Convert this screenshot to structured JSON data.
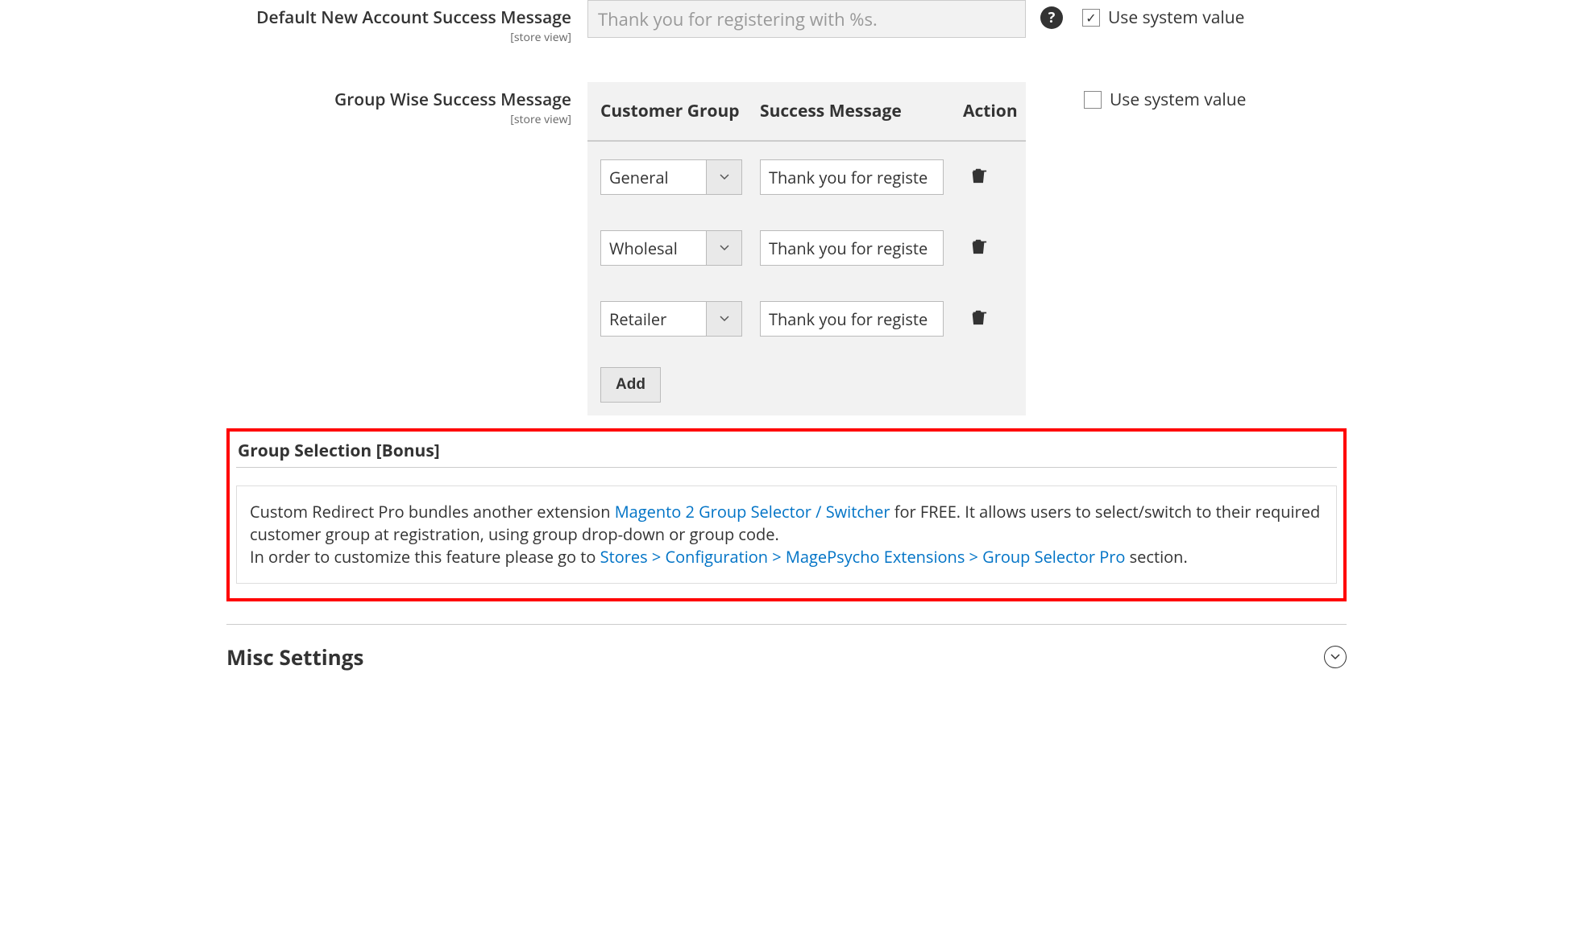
{
  "fields": {
    "default_success": {
      "label": "Default New Account Success Message",
      "scope": "[store view]",
      "value": "Thank you for registering with %s.",
      "use_system_label": "Use system value",
      "use_system_checked": true
    },
    "group_wise": {
      "label": "Group Wise Success Message",
      "scope": "[store view]",
      "use_system_label": "Use system value",
      "use_system_checked": false,
      "table": {
        "headers": {
          "group": "Customer Group",
          "message": "Success Message",
          "action": "Action"
        },
        "rows": [
          {
            "group": "General",
            "message": "Thank you for registe"
          },
          {
            "group": "Wholesal",
            "message": "Thank you for registe"
          },
          {
            "group": "Retailer",
            "message": "Thank you for registe"
          }
        ],
        "add_label": "Add"
      }
    }
  },
  "bonus": {
    "title": "Group Selection [Bonus]",
    "line1_prefix": "Custom Redirect Pro bundles another extension ",
    "line1_link": "Magento 2 Group Selector / Switcher",
    "line1_suffix": " for FREE. It allows users to select/switch to their required customer group at registration, using group drop-down or group code.",
    "line2_prefix": "In order to customize this feature please go to ",
    "line2_link": "Stores > Configuration > MagePsycho Extensions > Group Selector Pro",
    "line2_suffix": " section."
  },
  "misc_section": {
    "title": "Misc Settings"
  }
}
